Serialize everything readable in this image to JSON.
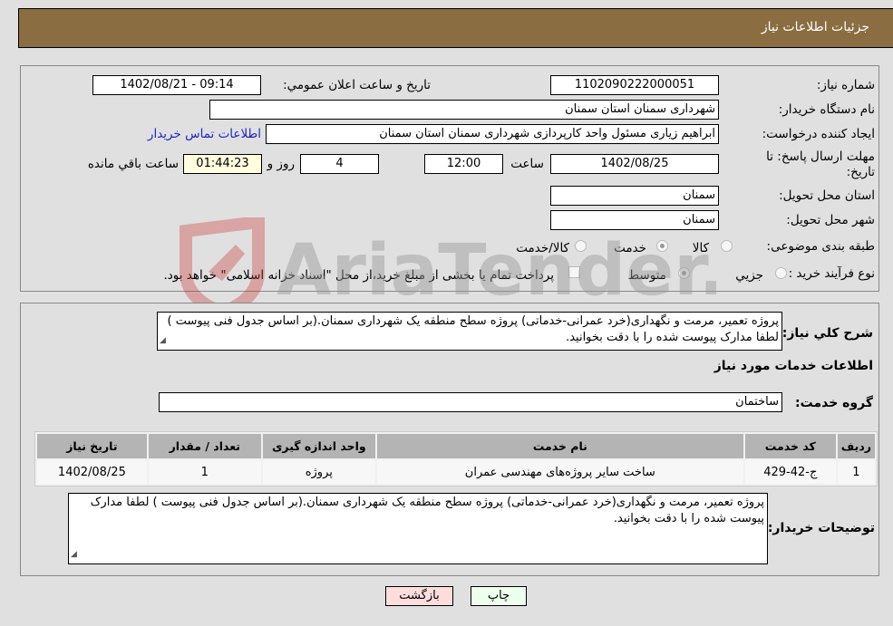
{
  "header": {
    "title": "جزئیات اطلاعات نیاز"
  },
  "form": {
    "need_number": {
      "label": "شماره نیاز:",
      "value": "1102090222000051"
    },
    "announce_datetime": {
      "label": "تاریخ و ساعت اعلان عمومي:",
      "value": "1402/08/21 - 09:14"
    },
    "buyer_org": {
      "label": "نام دستگاه خریدار:",
      "value": "شهرداری سمنان استان سمنان"
    },
    "requester": {
      "label": "ایجاد کننده درخواست:",
      "value": "ابراهیم زیاری مسئول واحد کارپردازی شهرداری سمنان استان سمنان"
    },
    "buyer_contact_link": "اطلاعات تماس خریدار",
    "deadline": {
      "label_line1": "مهلت ارسال پاسخ: تا",
      "label_line2": "تاریخ:",
      "date": "1402/08/25",
      "time_label": "ساعت",
      "time": "12:00",
      "days": "4",
      "days_label": "روز و",
      "remaining": "01:44:23",
      "remaining_label": "ساعت باقي مانده"
    },
    "delivery_province": {
      "label": "استان محل تحویل:",
      "value": "سمنان"
    },
    "delivery_city": {
      "label": "شهر محل تحویل:",
      "value": "سمنان"
    },
    "category": {
      "label": "طبقه بندی موضوعی:",
      "options": [
        "کالا",
        "خدمت",
        "کالا/خدمت"
      ],
      "selected": "خدمت"
    },
    "purchase_process": {
      "label": "نوع فرآیند خرید :",
      "options": [
        "جزيي",
        "متوسط"
      ],
      "selected": "متوسط",
      "treasury_note": "پرداخت تمام یا بخشی از مبلغ خرید،از محل \"اسناد خزانه اسلامی\" خواهد بود.",
      "treasury_checked": false
    }
  },
  "details": {
    "summary_label": "شرح کلي نیاز:",
    "summary_value": "پروژه تعمیر، مرمت و نگهداری(خرد عمرانی-خدماتی) پروژه سطح منطقه یک شهرداری سمنان.(بر اساس جدول فنی پیوست ) لطفا مدارک پیوست شده را با دقت بخوانید.",
    "services_heading": "اطلاعات خدمات مورد نیاز",
    "service_group_label": "گروه خدمت:",
    "service_group_value": "ساختمان",
    "table": {
      "headers": [
        "ردیف",
        "کد خدمت",
        "نام خدمت",
        "واحد اندازه گیری",
        "تعداد / مقدار",
        "تاریخ نیاز"
      ],
      "rows": [
        [
          "1",
          "ج-42-429",
          "ساخت سایر پروژه‌های مهندسی عمران",
          "پروژه",
          "1",
          "1402/08/25"
        ]
      ]
    },
    "buyer_notes_label": "توضیحات خریدار:",
    "buyer_notes_value": "پروژه تعمیر، مرمت و نگهداری(خرد عمرانی-خدماتی) پروژه سطح منطقه یک شهرداری سمنان.(بر اساس جدول فنی پیوست ) لطفا مدارک پیوست شده را با دقت بخوانید."
  },
  "buttons": {
    "print": "چاپ",
    "back": "بازگشت"
  },
  "colors": {
    "header": "#8b6d42",
    "link": "#2222cc",
    "print_bg": "#eeffee",
    "back_bg": "#ffdddd"
  },
  "watermark": {
    "text": "AriaTender.neT"
  }
}
